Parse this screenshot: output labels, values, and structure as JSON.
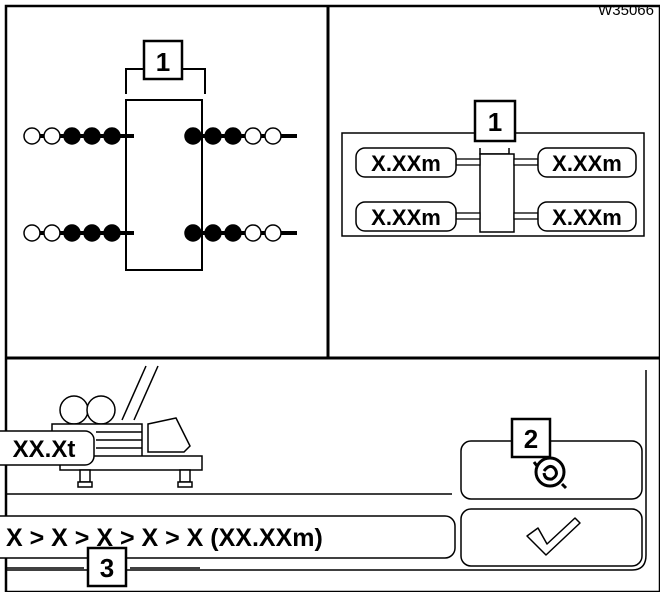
{
  "reference_code": "W35066",
  "top_left_panel": {
    "callout_number": "1",
    "rows": 2,
    "pins_per_side": 5,
    "extended_pins_per_side": 3
  },
  "top_right_panel": {
    "callout_number": "1",
    "lengths": {
      "front_left": "X.XXm",
      "front_right": "X.XXm",
      "rear_left": "X.XXm",
      "rear_right": "X.XXm"
    }
  },
  "bottom_panel": {
    "load_label": "XX.Xt",
    "sequence_text": "X > X > X > X > X  (XX.XXm)",
    "callout_button": "2",
    "callout_sequence": "3",
    "settings_button_icon": "fan-settings-icon",
    "confirm_button_icon": "checkmark-icon"
  }
}
